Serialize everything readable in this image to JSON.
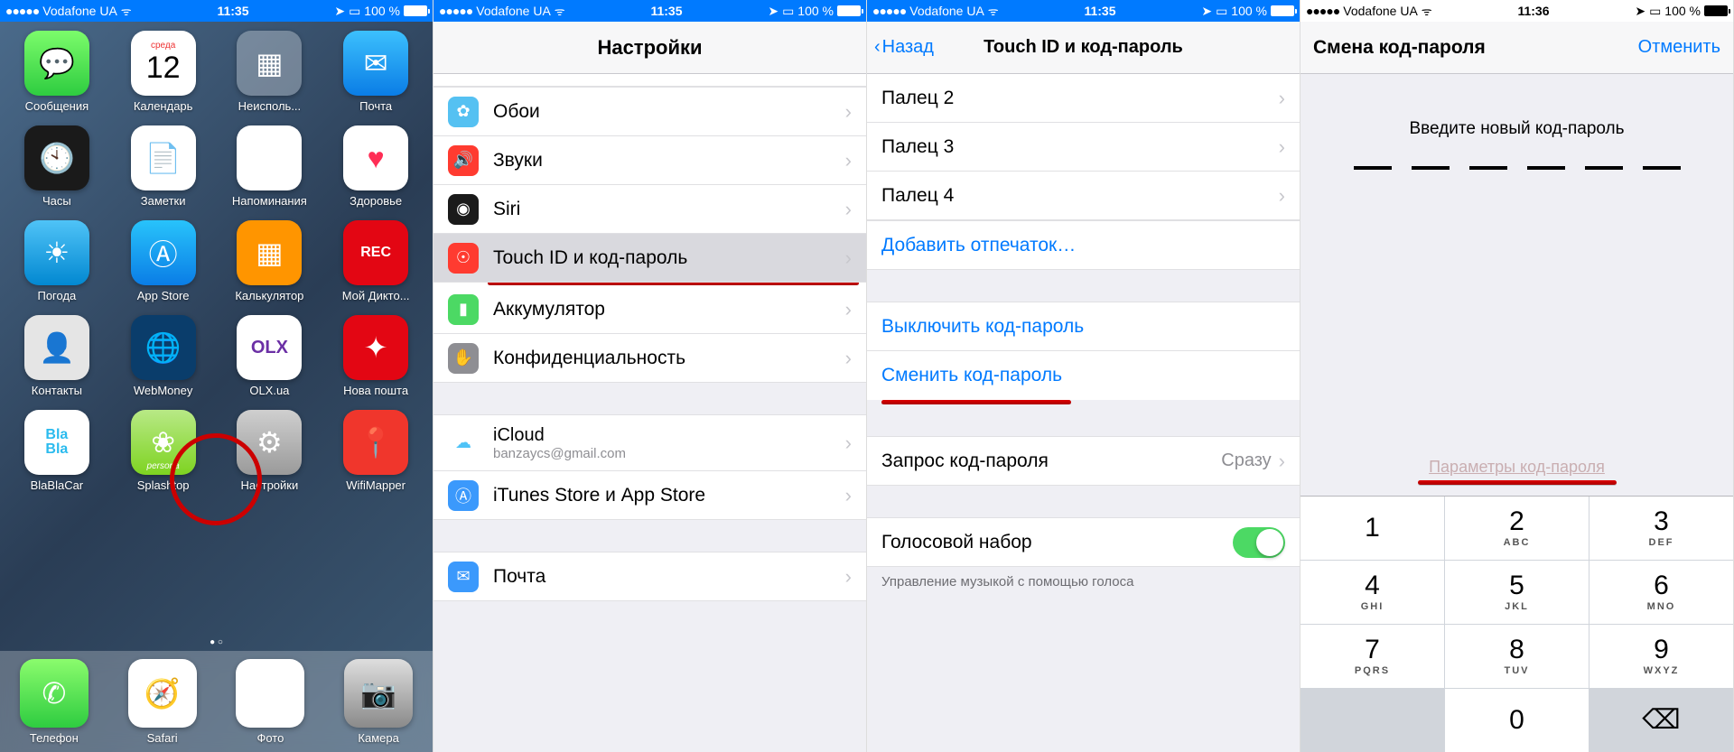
{
  "status_bar": {
    "carrier": "Vodafone UA",
    "time1": "11:35",
    "time2": "11:36",
    "battery": "100 %",
    "signal_dots": "●●●●●"
  },
  "screen1": {
    "apps": [
      {
        "label": "Сообщения",
        "icon": "message"
      },
      {
        "label": "Календарь",
        "icon": "calendar",
        "day": "среда",
        "num": "12"
      },
      {
        "label": "Неисполь...",
        "icon": "folder"
      },
      {
        "label": "Почта",
        "icon": "mail"
      },
      {
        "label": "Часы",
        "icon": "clock"
      },
      {
        "label": "Заметки",
        "icon": "notes"
      },
      {
        "label": "Напоминания",
        "icon": "reminders"
      },
      {
        "label": "Здоровье",
        "icon": "health"
      },
      {
        "label": "Погода",
        "icon": "weather"
      },
      {
        "label": "App Store",
        "icon": "appstore"
      },
      {
        "label": "Калькулятор",
        "icon": "calculator"
      },
      {
        "label": "Мой Дикто...",
        "icon": "recorder",
        "text": "REC"
      },
      {
        "label": "Контакты",
        "icon": "contacts"
      },
      {
        "label": "WebMoney",
        "icon": "webmoney"
      },
      {
        "label": "OLX.ua",
        "icon": "olx",
        "text": "OLX"
      },
      {
        "label": "Нова пошта",
        "icon": "novaposhta"
      },
      {
        "label": "BlaBlaCar",
        "icon": "blabla",
        "text": "Bla\nBla"
      },
      {
        "label": "Splashtop",
        "icon": "splashtop",
        "sub": "persona"
      },
      {
        "label": "Настройки",
        "icon": "settings"
      },
      {
        "label": "WifiMapper",
        "icon": "wifimapper"
      }
    ],
    "dock": [
      {
        "label": "Телефон",
        "icon": "phone"
      },
      {
        "label": "Safari",
        "icon": "safari"
      },
      {
        "label": "Фото",
        "icon": "photos"
      },
      {
        "label": "Камера",
        "icon": "camera"
      }
    ]
  },
  "screen2": {
    "title": "Настройки",
    "rows": [
      {
        "label": "Обои",
        "icon": "wallpaper",
        "color": "ri-wall"
      },
      {
        "label": "Звуки",
        "icon": "sounds",
        "color": "ri-sound"
      },
      {
        "label": "Siri",
        "icon": "siri",
        "color": "ri-siri"
      },
      {
        "label": "Touch ID и код-пароль",
        "icon": "touchid",
        "color": "ri-touch",
        "highlighted": true
      },
      {
        "label": "Аккумулятор",
        "icon": "battery",
        "color": "ri-batt"
      },
      {
        "label": "Конфиденциальность",
        "icon": "privacy",
        "color": "ri-priv"
      }
    ],
    "group2": [
      {
        "label": "iCloud",
        "sub": "banzaycs@gmail.com",
        "color": "ri-icloud"
      },
      {
        "label": "iTunes Store и App Store",
        "color": "ri-itunes"
      }
    ],
    "group3": [
      {
        "label": "Почта",
        "color": "ri-mailapp"
      }
    ]
  },
  "screen3": {
    "back": "Назад",
    "title": "Touch ID и код-пароль",
    "fingers": [
      "Палец 2",
      "Палец 3",
      "Палец 4"
    ],
    "add_fingerprint": "Добавить отпечаток…",
    "turn_off": "Выключить код-пароль",
    "change": "Сменить код-пароль",
    "require": {
      "label": "Запрос код-пароля",
      "value": "Сразу"
    },
    "voice_dial": "Голосовой набор",
    "footer": "Управление музыкой с помощью голоса"
  },
  "screen4": {
    "title": "Смена код-пароля",
    "cancel": "Отменить",
    "prompt": "Введите новый код-пароль",
    "options": "Параметры код-пароля",
    "keys": [
      {
        "n": "1",
        "l": ""
      },
      {
        "n": "2",
        "l": "ABC"
      },
      {
        "n": "3",
        "l": "DEF"
      },
      {
        "n": "4",
        "l": "GHI"
      },
      {
        "n": "5",
        "l": "JKL"
      },
      {
        "n": "6",
        "l": "MNO"
      },
      {
        "n": "7",
        "l": "PQRS"
      },
      {
        "n": "8",
        "l": "TUV"
      },
      {
        "n": "9",
        "l": "WXYZ"
      },
      {
        "n": "",
        "l": "",
        "gray": true
      },
      {
        "n": "0",
        "l": ""
      },
      {
        "n": "⌫",
        "l": "",
        "gray": true
      }
    ]
  }
}
